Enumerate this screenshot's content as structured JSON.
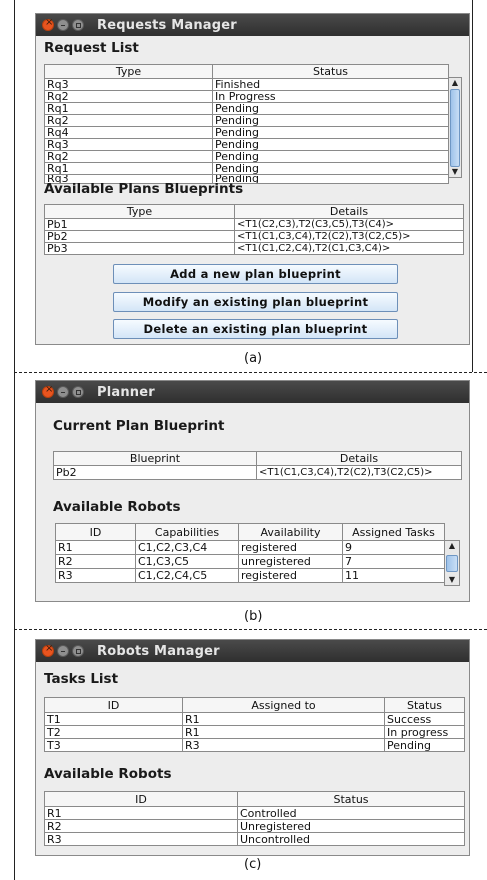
{
  "requests_window": {
    "title": "Requests Manager",
    "request_list": {
      "heading": "Request List",
      "columns": [
        "Type",
        "Status"
      ],
      "rows": [
        [
          "Rq3",
          "Finished"
        ],
        [
          "Rq2",
          "In Progress"
        ],
        [
          "Rq1",
          "Pending"
        ],
        [
          "Rq2",
          "Pending"
        ],
        [
          "Rq4",
          "Pending"
        ],
        [
          "Rq3",
          "Pending"
        ],
        [
          "Rq2",
          "Pending"
        ],
        [
          "Rq1",
          "Pending"
        ],
        [
          "Rq3",
          "Pending"
        ]
      ]
    },
    "plans": {
      "heading": "Available Plans Blueprints",
      "columns": [
        "Type",
        "Details"
      ],
      "rows": [
        [
          "Pb1",
          "<T1(C2,C3),T2(C3,C5),T3(C4)>"
        ],
        [
          "Pb2",
          "<T1(C1,C3,C4),T2(C2),T3(C2,C5)>"
        ],
        [
          "Pb3",
          "<T1(C1,C2,C4),T2(C1,C3,C4)>"
        ]
      ]
    },
    "buttons": {
      "add": "Add a new plan blueprint",
      "modify": "Modify an existing plan blueprint",
      "delete": "Delete an existing plan blueprint"
    },
    "caption": "(a)"
  },
  "planner_window": {
    "title": "Planner",
    "current": {
      "heading": "Current Plan Blueprint",
      "columns": [
        "Blueprint",
        "Details"
      ],
      "rows": [
        [
          "Pb2",
          "<T1(C1,C3,C4),T2(C2),T3(C2,C5)>"
        ]
      ]
    },
    "robots": {
      "heading": "Available Robots",
      "columns": [
        "ID",
        "Capabilities",
        "Availability",
        "Assigned Tasks"
      ],
      "rows": [
        [
          "R1",
          "C1,C2,C3,C4",
          "registered",
          "9"
        ],
        [
          "R2",
          "C1,C3,C5",
          "unregistered",
          "7"
        ],
        [
          "R3",
          "C1,C2,C4,C5",
          "registered",
          "11"
        ]
      ]
    },
    "caption": "(b)"
  },
  "robots_window": {
    "title": "Robots Manager",
    "tasks": {
      "heading": "Tasks List",
      "columns": [
        "ID",
        "Assigned to",
        "Status"
      ],
      "rows": [
        [
          "T1",
          "R1",
          "Success"
        ],
        [
          "T2",
          "R1",
          "In progress"
        ],
        [
          "T3",
          "R3",
          "Pending"
        ]
      ]
    },
    "robots": {
      "heading": "Available Robots",
      "columns": [
        "ID",
        "Status"
      ],
      "rows": [
        [
          "R1",
          "Controlled"
        ],
        [
          "R2",
          "Unregistered"
        ],
        [
          "R3",
          "Uncontrolled"
        ]
      ]
    },
    "caption": "(c)"
  },
  "icons": [
    "close-icon",
    "minimize-icon",
    "maximize-icon",
    "scroll-up-icon",
    "scroll-down-icon"
  ]
}
